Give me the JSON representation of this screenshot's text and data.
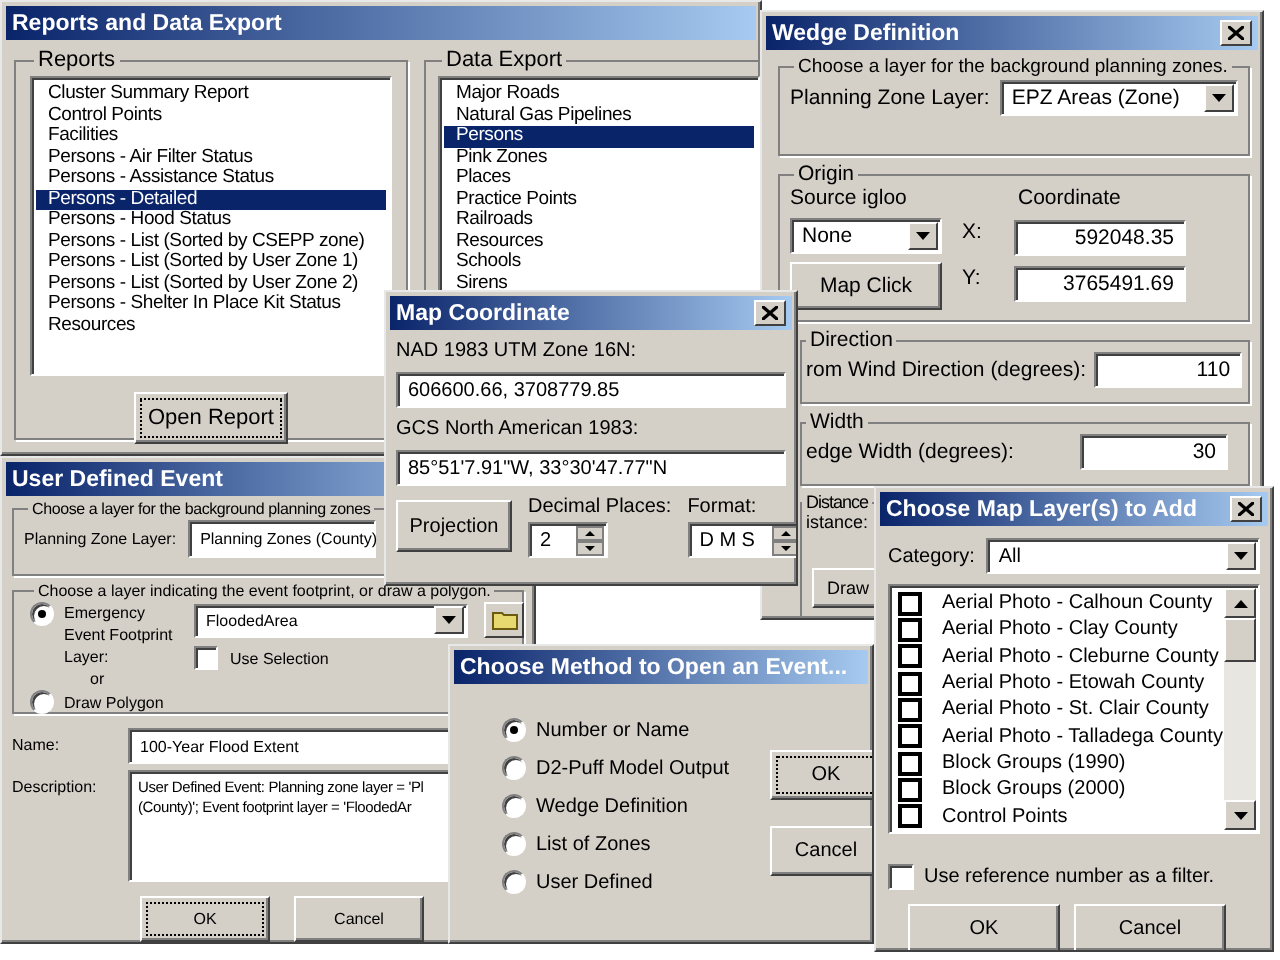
{
  "reports_window": {
    "title": "Reports and Data Export",
    "reports": {
      "label": "Reports",
      "button": "Open Report",
      "items": [
        {
          "label": "Cluster Summary Report",
          "selected": false
        },
        {
          "label": "Control Points",
          "selected": false
        },
        {
          "label": "Facilities",
          "selected": false
        },
        {
          "label": "Persons - Air Filter Status",
          "selected": false
        },
        {
          "label": "Persons - Assistance Status",
          "selected": false
        },
        {
          "label": "Persons - Detailed",
          "selected": true
        },
        {
          "label": "Persons - Hood Status",
          "selected": false
        },
        {
          "label": "Persons - List (Sorted by CSEPP zone)",
          "selected": false
        },
        {
          "label": "Persons - List (Sorted by User Zone 1)",
          "selected": false
        },
        {
          "label": "Persons - List (Sorted by User Zone 2)",
          "selected": false
        },
        {
          "label": "Persons - Shelter In Place Kit Status",
          "selected": false
        },
        {
          "label": "Resources",
          "selected": false
        }
      ]
    },
    "data_export": {
      "label": "Data Export",
      "items": [
        {
          "label": "Major Roads",
          "selected": false
        },
        {
          "label": "Natural Gas Pipelines",
          "selected": false
        },
        {
          "label": "Persons",
          "selected": true
        },
        {
          "label": "Pink Zones",
          "selected": false
        },
        {
          "label": "Places",
          "selected": false
        },
        {
          "label": "Practice Points",
          "selected": false
        },
        {
          "label": "Railroads",
          "selected": false
        },
        {
          "label": "Resources",
          "selected": false
        },
        {
          "label": "Schools",
          "selected": false
        },
        {
          "label": "Sirens",
          "selected": false
        }
      ]
    }
  },
  "wedge_window": {
    "title": "Wedge Definition",
    "zone_group": {
      "label": "Choose a layer for the background planning zones.",
      "field_label": "Planning Zone Layer:",
      "value": "EPZ Areas (Zone)"
    },
    "origin": {
      "label": "Origin",
      "source_label": "Source igloo",
      "source_value": "None",
      "coordinate_label": "Coordinate",
      "x_label": "X:",
      "x_value": "592048.35",
      "y_label": "Y:",
      "y_value": "3765491.69",
      "button": "Map Click"
    },
    "direction": {
      "label": "Direction",
      "field_label": "rom Wind Direction (degrees):",
      "value": "110"
    },
    "width": {
      "label": "Width",
      "field_label": "edge Width (degrees):",
      "value": "30"
    },
    "distance": {
      "label": "Distance",
      "field_label": "istance:",
      "button": "Draw"
    }
  },
  "user_event_window": {
    "title": "User Defined Event",
    "zone_group": {
      "label": "Choose a layer for the background planning zones",
      "field_label": "Planning Zone Layer:",
      "value": "Planning Zones (County)"
    },
    "footprint_group": {
      "label": "Choose a layer indicating the event footprint, or draw a polygon.",
      "options": [
        {
          "label": "Emergency Event Footprint Layer:",
          "selected": true
        },
        {
          "label": "Draw Polygon",
          "selected": false
        }
      ],
      "or": "or",
      "layer_value": "FloodedArea",
      "use_selection": {
        "label": "Use Selection",
        "checked": false
      }
    },
    "name_label": "Name:",
    "name_value": "100-Year Flood Extent",
    "description_label": "Description:",
    "description_lines": [
      "User Defined Event: Planning zone layer = 'Pl",
      "(County)'; Event footprint layer = 'FloodedAr"
    ],
    "buttons": [
      "OK",
      "Cancel"
    ]
  },
  "map_coordinate_window": {
    "title": "Map Coordinate",
    "utm_label": "NAD 1983 UTM Zone 16N:",
    "utm_value": "606600.66, 3708779.85",
    "gcs_label": "GCS North American 1983:",
    "gcs_value": "85°51'7.91\"W, 33°30'47.77\"N",
    "button": "Projection",
    "decimal_label": "Decimal Places:",
    "decimal_value": "2",
    "format_label": "Format:",
    "format_value": "D M S"
  },
  "open_event_window": {
    "title": "Choose Method to Open an Event...",
    "options": [
      {
        "label": "Number or Name",
        "selected": true
      },
      {
        "label": "D2-Puff Model Output",
        "selected": false
      },
      {
        "label": "Wedge Definition",
        "selected": false
      },
      {
        "label": "List of Zones",
        "selected": false
      },
      {
        "label": "User Defined",
        "selected": false
      }
    ],
    "buttons": [
      "OK",
      "Cancel"
    ]
  },
  "map_layers_window": {
    "title": "Choose Map Layer(s) to Add",
    "category_label": "Category:",
    "category_value": "All",
    "layers": [
      {
        "label": "Aerial Photo - Calhoun County",
        "checked": false
      },
      {
        "label": "Aerial Photo - Clay County",
        "checked": false
      },
      {
        "label": "Aerial Photo - Cleburne County",
        "checked": false
      },
      {
        "label": "Aerial Photo - Etowah County",
        "checked": false
      },
      {
        "label": "Aerial Photo - St. Clair County",
        "checked": false
      },
      {
        "label": "Aerial Photo - Talladega County",
        "checked": false
      },
      {
        "label": "Block Groups (1990)",
        "checked": false
      },
      {
        "label": "Block Groups (2000)",
        "checked": false
      },
      {
        "label": "Control Points",
        "checked": false
      }
    ],
    "filter": {
      "label": "Use reference number as a filter.",
      "checked": false
    },
    "buttons": [
      "OK",
      "Cancel"
    ]
  }
}
